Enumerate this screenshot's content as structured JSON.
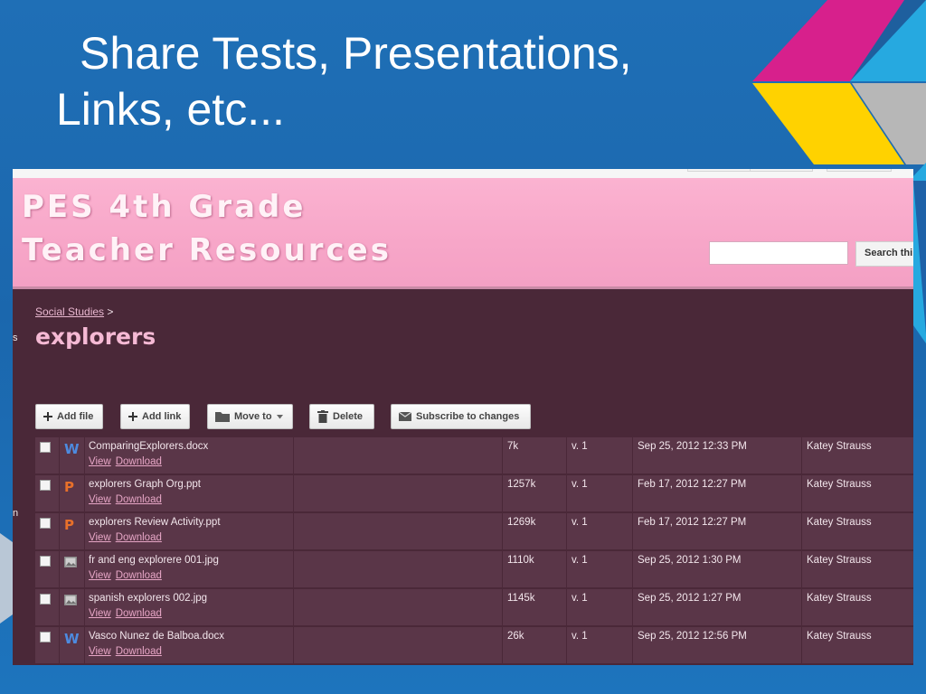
{
  "slide": {
    "title_line1": "Share Tests, Presentations,",
    "title_line2": "Links, etc..."
  },
  "colors": {
    "slide_bg": "#1f6fb6",
    "header_pink": "#f7a6c8",
    "content_bg": "#4a2838",
    "row_bg": "#5a3648",
    "title_pink": "#f5b9d4",
    "deco_magenta": "#d7208c",
    "deco_yellow": "#ffd200",
    "deco_cyan": "#26a9e0",
    "deco_gray": "#b7b7b7"
  },
  "site": {
    "title_line1": "PES 4th Grade",
    "title_line2": "Teacher Resources",
    "search_button": "Search thi"
  },
  "side_fragments": [
    "s",
    "n"
  ],
  "breadcrumb": {
    "parent": "Social Studies",
    "separator": ">"
  },
  "page_title": "explorers",
  "toolbar": {
    "add_file": "Add file",
    "add_link": "Add link",
    "move_to": "Move to",
    "delete": "Delete",
    "subscribe": "Subscribe to changes"
  },
  "files": [
    {
      "icon": "word-icon",
      "glyph": "W",
      "name": "ComparingExplorers.docx",
      "view": "View",
      "download": "Download",
      "size": "7k",
      "version": "v. 1",
      "date": "Sep 25, 2012 12:33 PM",
      "user": "Katey Strauss"
    },
    {
      "icon": "powerpoint-icon",
      "glyph": "P",
      "name": "explorers Graph Org.ppt",
      "view": "View",
      "download": "Download",
      "size": "1257k",
      "version": "v. 1",
      "date": "Feb 17, 2012 12:27 PM",
      "user": "Katey Strauss"
    },
    {
      "icon": "powerpoint-icon",
      "glyph": "P",
      "name": "explorers Review Activity.ppt",
      "view": "View",
      "download": "Download",
      "size": "1269k",
      "version": "v. 1",
      "date": "Feb 17, 2012 12:27 PM",
      "user": "Katey Strauss"
    },
    {
      "icon": "image-icon",
      "glyph": "",
      "name": "fr and eng explorere 001.jpg",
      "view": "View",
      "download": "Download",
      "size": "1110k",
      "version": "v. 1",
      "date": "Sep 25, 2012 1:30 PM",
      "user": "Katey Strauss"
    },
    {
      "icon": "image-icon",
      "glyph": "",
      "name": "spanish explorers 002.jpg",
      "view": "View",
      "download": "Download",
      "size": "1145k",
      "version": "v. 1",
      "date": "Sep 25, 2012 1:27 PM",
      "user": "Katey Strauss"
    },
    {
      "icon": "word-icon",
      "glyph": "W",
      "name": "Vasco Nunez de Balboa.docx",
      "view": "View",
      "download": "Download",
      "size": "26k",
      "version": "v. 1",
      "date": "Sep 25, 2012 12:56 PM",
      "user": "Katey Strauss"
    }
  ]
}
